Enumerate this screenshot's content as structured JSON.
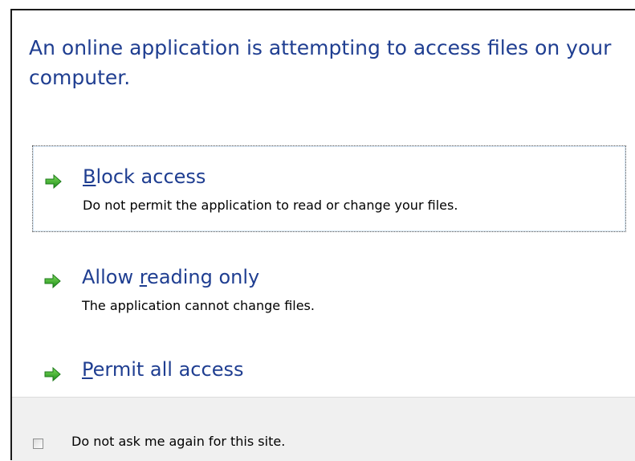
{
  "dialog": {
    "headline": "An online application is attempting to access files on your computer."
  },
  "options": [
    {
      "mnemonic": "B",
      "title_rest": "lock access",
      "description": "Do not permit the application to read or change your files.",
      "focused": true,
      "icon": "green-arrow-icon"
    },
    {
      "title_before": "Allow ",
      "mnemonic": "r",
      "title_rest": "eading only",
      "description": "The application cannot change files.",
      "icon": "green-arrow-icon"
    },
    {
      "mnemonic": "P",
      "title_rest": "ermit all access",
      "icon": "green-arrow-icon"
    }
  ],
  "footer": {
    "checkbox_label": "Do not ask me again for this site.",
    "checked": false
  },
  "colors": {
    "title": "#1f3e91",
    "arrow": "#2fa52a",
    "footer_bg": "#f0f0f0"
  }
}
